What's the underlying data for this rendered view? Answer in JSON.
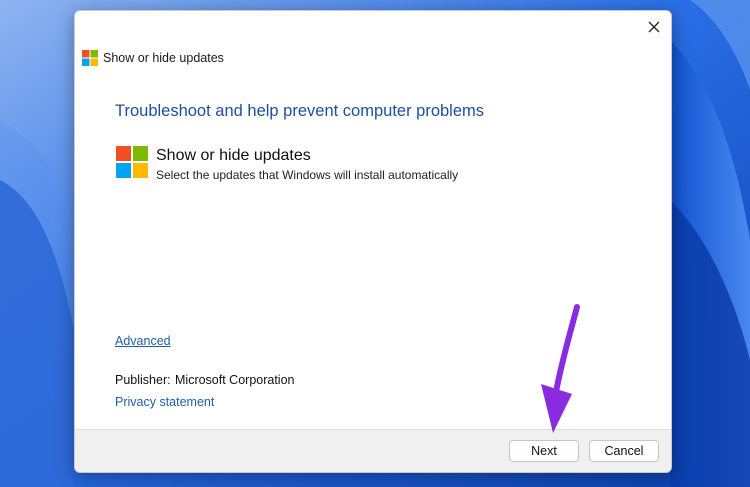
{
  "window": {
    "title": "Show or hide updates",
    "close_icon": "close-icon"
  },
  "content": {
    "heading": "Troubleshoot and help prevent computer problems",
    "app_name": "Show or hide updates",
    "app_description": "Select the updates that Windows will install automatically",
    "advanced_link": "Advanced",
    "publisher_label": "Publisher:",
    "publisher_value": "Microsoft Corporation",
    "privacy_link": "Privacy statement"
  },
  "footer": {
    "next_label": "Next",
    "cancel_label": "Cancel"
  },
  "colors": {
    "accent_heading": "#1f4e9e",
    "link": "#1f5fa8",
    "arrow": "#8a2be2",
    "logo_red": "#f25022",
    "logo_green": "#7fba00",
    "logo_blue": "#00a4ef",
    "logo_yellow": "#ffb900"
  }
}
